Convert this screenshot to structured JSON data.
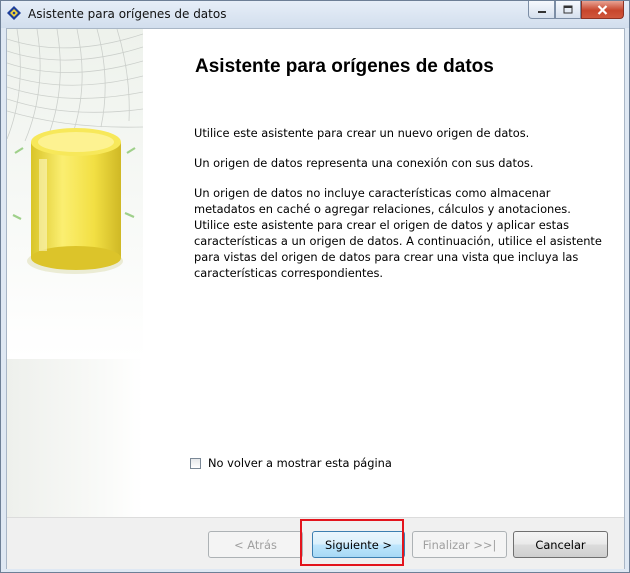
{
  "window": {
    "title": "Asistente para orígenes de datos",
    "icon": "wizard-diamond-icon"
  },
  "main": {
    "heading": "Asistente para orígenes de datos",
    "paragraph1": "Utilice este asistente para crear un nuevo origen de datos.",
    "paragraph2": "Un origen de datos representa una conexión con sus datos.",
    "paragraph3": "Un origen de datos no incluye características como almacenar metadatos en caché o agregar relaciones, cálculos y anotaciones. Utilice este asistente para crear el origen de datos y aplicar estas características a un origen de datos. A continuación, utilice el asistente para vistas del origen de datos para crear una vista que incluya las características correspondientes.",
    "dont_show_again": {
      "label": "No volver a mostrar esta página",
      "checked": false
    }
  },
  "buttons": {
    "back": "< Atrás",
    "next": "Siguiente >",
    "finish": "Finalizar >>|",
    "cancel": "Cancelar"
  },
  "colors": {
    "highlight": "#e3141c",
    "database_art": "#f2e04a"
  }
}
